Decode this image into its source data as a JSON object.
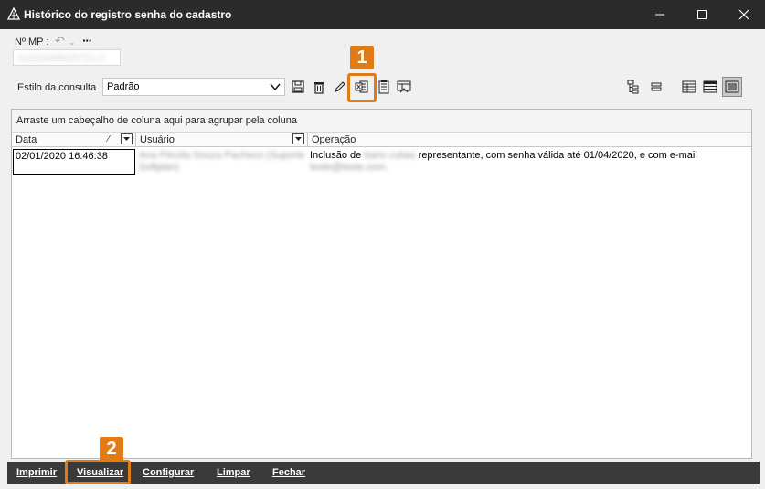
{
  "window": {
    "title": "Histórico do registro senha do cadastro",
    "icons": {
      "app": "app-logo-icon",
      "minimize": "minimize-icon",
      "maximize": "maximize-icon",
      "close": "close-icon"
    }
  },
  "header": {
    "mp_label": "Nº MP :",
    "mp_value": "01201668025721.0",
    "undo_icon": "undo-icon",
    "more_label": "···"
  },
  "consulta": {
    "label": "Estilo da consulta",
    "selected": "Padrão",
    "toolbar_icons": [
      "save-icon",
      "delete-icon",
      "edit-icon",
      "export-excel-icon",
      "report-icon",
      "layout-icon"
    ],
    "right_icons": [
      "tree-expand-icon",
      "tree-collapse-icon",
      "grid-view-icon",
      "list-view-icon",
      "card-view-icon"
    ]
  },
  "grid": {
    "group_hint": "Arraste um cabeçalho de coluna aqui para agrupar pela coluna",
    "columns": [
      "Data",
      "Usuário",
      "Operação"
    ],
    "rows": [
      {
        "data": "02/01/2020 16:46:38",
        "usuario": "Ana Pércila Souza Pacheco (Suporte Softplan)",
        "operacao_prefix": "Inclusão de",
        "operacao_name": "bans cubas",
        "operacao_suffix": "representante, com senha válida até 01/04/2020, e com e-mail",
        "operacao_email": "teste@teste.com."
      }
    ]
  },
  "annotations": {
    "badge1": "1",
    "badge2": "2",
    "color": "#e07b16"
  },
  "footer": {
    "buttons": [
      "Imprimir",
      "Visualizar",
      "Configurar",
      "Limpar",
      "Fechar"
    ]
  }
}
